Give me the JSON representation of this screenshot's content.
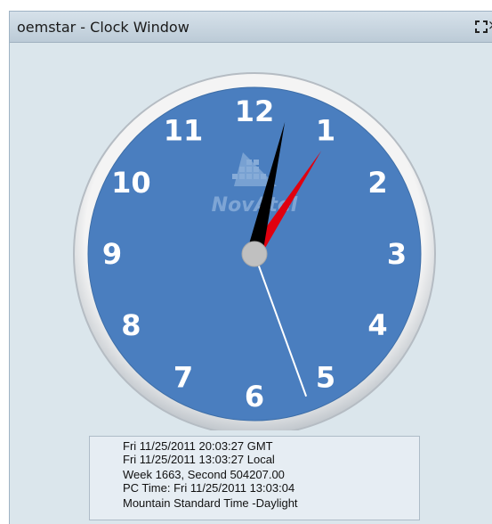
{
  "window": {
    "title": "oemstar - Clock Window",
    "maximize_icon": "maximize-icon",
    "close_icon": "close-icon",
    "close_glyph": "×"
  },
  "clock": {
    "numerals": [
      "12",
      "1",
      "2",
      "3",
      "4",
      "5",
      "6",
      "7",
      "8",
      "9",
      "10",
      "11"
    ],
    "watermark_text": "NovAtel",
    "displayed_time": "13:03:27",
    "face_color": "#4a7ebf",
    "hour_hand_color": "#000000",
    "minute_hand_color": "#e0000f",
    "second_hand_color": "#ffffff"
  },
  "info": {
    "gmt": "Fri 11/25/2011 20:03:27 GMT",
    "local": "Fri 11/25/2011 13:03:27 Local",
    "week": "Week 1663, Second 504207.00",
    "pc_time": "PC Time: Fri 11/25/2011 13:03:04",
    "timezone": "Mountain Standard Time -Daylight"
  }
}
